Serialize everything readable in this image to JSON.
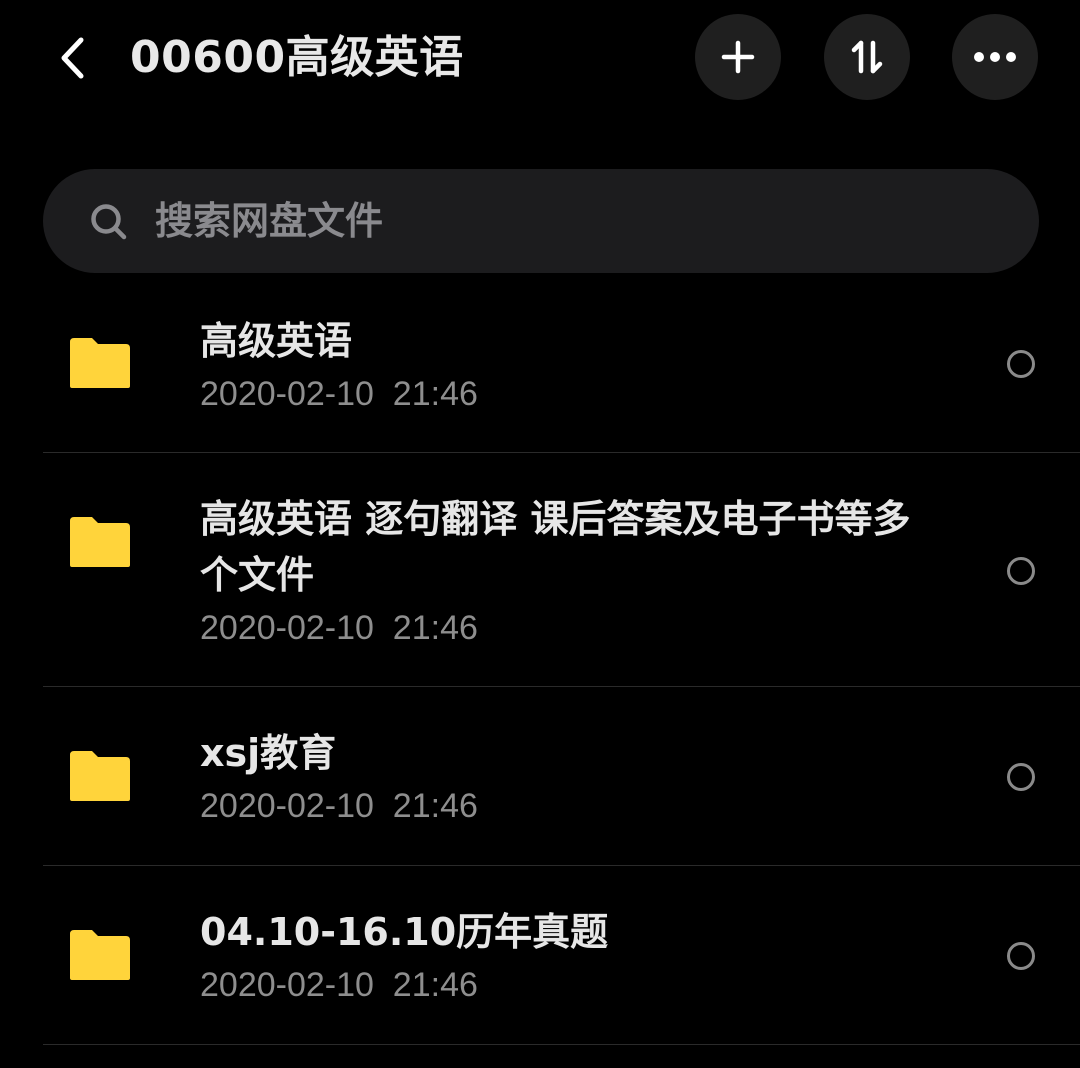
{
  "header": {
    "title": "00600高级英语",
    "back_icon": "chevron-left-icon",
    "add_icon": "plus-icon",
    "sort_icon": "sort-icon",
    "more_icon": "more-horizontal-icon"
  },
  "search": {
    "placeholder": "搜索网盘文件",
    "icon": "search-icon"
  },
  "colors": {
    "background": "#000000",
    "folder": "#FFD43B",
    "button_bg": "#1f1f1f",
    "search_bg": "#1c1c1e",
    "text_primary": "#e6e6e6",
    "text_secondary": "#8e8e8e"
  },
  "files": [
    {
      "name": "高级英语",
      "date": "2020-02-10  21:46",
      "icon": "folder-icon"
    },
    {
      "name": "高级英语 逐句翻译 课后答案及电子书等多个文件",
      "date": "2020-02-10  21:46",
      "icon": "folder-icon"
    },
    {
      "name": "xsj教育",
      "date": "2020-02-10  21:46",
      "icon": "folder-icon"
    },
    {
      "name": "04.10-16.10历年真题",
      "date": "2020-02-10  21:46",
      "icon": "folder-icon"
    }
  ]
}
